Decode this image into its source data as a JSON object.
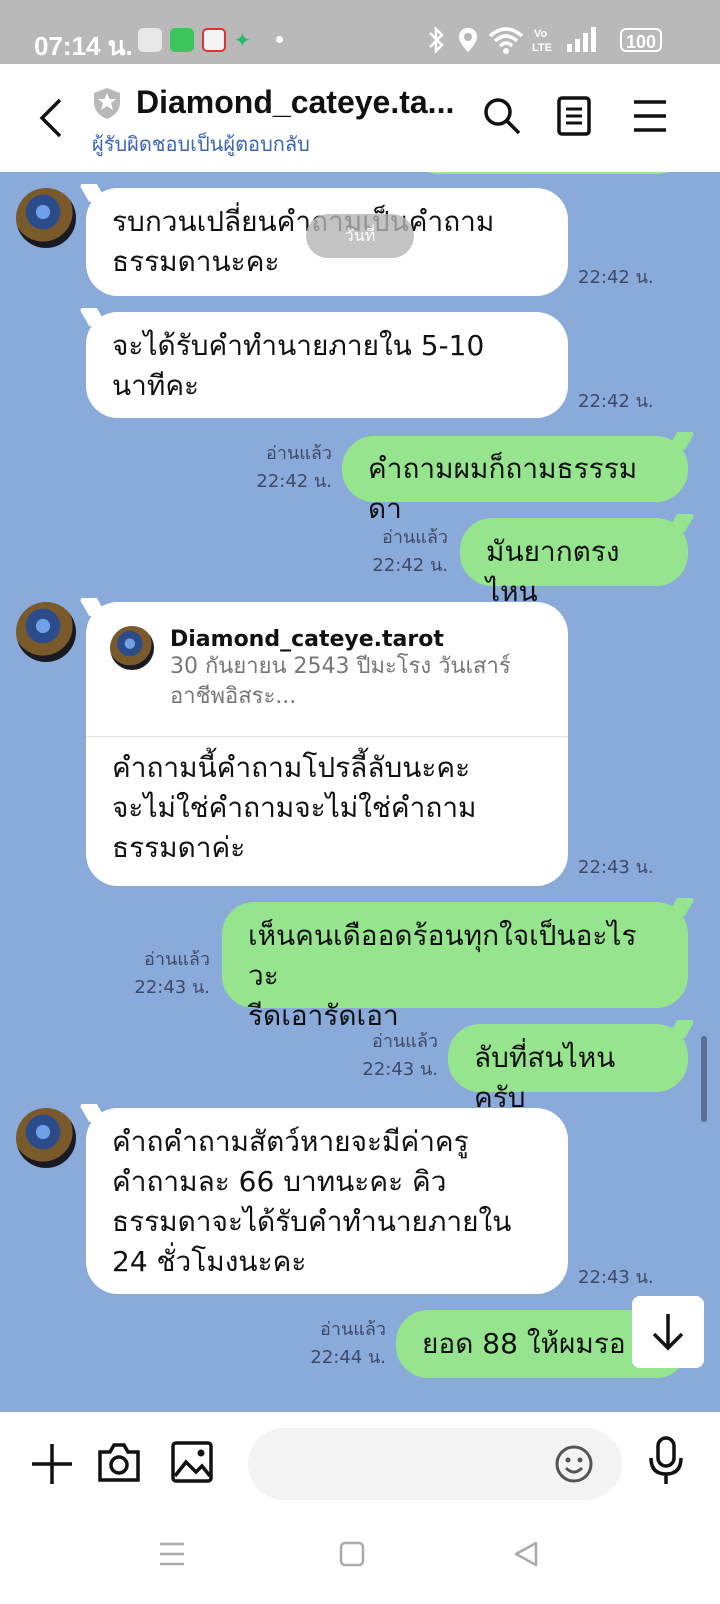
{
  "status_bar": {
    "time": "07:14 น.",
    "battery": "100"
  },
  "header": {
    "title": "Diamond_cateye.ta...",
    "subtitle": "ผู้รับผิดชอบเป็นผู้ตอบกลับ"
  },
  "overlay_label": "วันที่",
  "messages": [
    {
      "text": "รบกวนเปลี่ยนคำถามเป็นคำถาม\nธรรมดานะคะ",
      "time": "22:42 น."
    },
    {
      "text": "จะได้รับคำทำนายภายใน 5-10\nนาทีคะ",
      "time": "22:42 น."
    },
    {
      "text": "คำถามผมก็ถามธรรรมดา",
      "read": "อ่านแล้ว",
      "time": "22:42 น."
    },
    {
      "text": "มันยากตรงไหน",
      "read": "อ่านแล้ว",
      "time": "22:42 น."
    },
    {
      "reply_name": "Diamond_cateye.tarot",
      "reply_text": "30 กันยายน 2543 ปีมะโรง วันเสาร์\nอาชีพอิสระ...",
      "text": "คำถามนี้คำถามโปรลี้ลับนะคะ\nจะไม่ใช่คำถามจะไม่ใช่คำถาม\nธรรมดาค่ะ",
      "time": "22:43 น."
    },
    {
      "text": "เห็นคนเดืออดร้อนทุกใจเป็นอะไรวะ\nรีดเอารัดเอา",
      "read": "อ่านแล้ว",
      "time": "22:43 น."
    },
    {
      "text": "ลับที่สนไหนครับ",
      "read": "อ่านแล้ว",
      "time": "22:43 น."
    },
    {
      "text": "คำถคำถามสัตว์หายจะมีค่าครู\nคำถามละ 66 บาทนะคะ คิว\nธรรมดาจะได้รับคำทำนายภายใน\n24 ชั่วโมงนะคะ",
      "time": "22:43 น."
    },
    {
      "text": "ยอด 88 ให้ผมรอ",
      "read": "อ่านแล้ว",
      "time": "22:44 น."
    }
  ],
  "colors": {
    "chat_bg": "#8aaad9",
    "outgoing": "#96e58e",
    "incoming": "#ffffff",
    "accent": "#3a65b8"
  }
}
